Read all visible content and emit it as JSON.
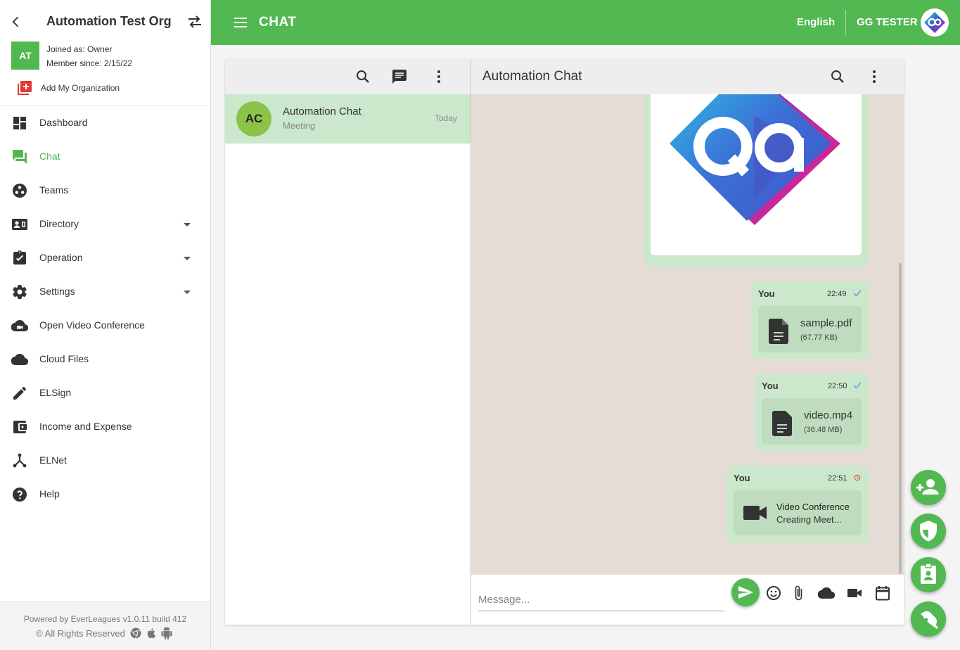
{
  "colors": {
    "primary": "#52b852",
    "selected_row": "#cce8cc",
    "chat_bg": "#e5ddd5",
    "active_nav": "#4fb84f"
  },
  "sidebar": {
    "org_name": "Automation Test Org",
    "org_initials": "AT",
    "joined": "Joined as: Owner",
    "member_since": "Member since: 2/15/22",
    "add_org": "Add My Organization",
    "items": [
      {
        "label": "Dashboard",
        "icon": "dashboard-icon"
      },
      {
        "label": "Chat",
        "icon": "chat-icon",
        "active": true
      },
      {
        "label": "Teams",
        "icon": "teams-icon"
      },
      {
        "label": "Directory",
        "icon": "contact-card-icon",
        "expandable": true
      },
      {
        "label": "Operation",
        "icon": "assignment-icon",
        "expandable": true
      },
      {
        "label": "Settings",
        "icon": "gear-icon",
        "expandable": true
      },
      {
        "label": "Open Video Conference",
        "icon": "video-cloud-icon"
      },
      {
        "label": "Cloud Files",
        "icon": "cloud-icon"
      },
      {
        "label": "ELSign",
        "icon": "pen-icon"
      },
      {
        "label": "Income and Expense",
        "icon": "wallet-icon"
      },
      {
        "label": "ELNet",
        "icon": "network-icon"
      },
      {
        "label": "Help",
        "icon": "help-icon"
      }
    ],
    "footer": {
      "powered": "Powered by EverLeagues v1.0.11 build 412",
      "rights": "© All Rights Reserved"
    }
  },
  "topbar": {
    "title": "CHAT",
    "language": "English",
    "user_name": "GG TESTER"
  },
  "chat_list": {
    "items": [
      {
        "initials": "AC",
        "name": "Automation Chat",
        "subtitle": "Meeting",
        "time": "Today"
      }
    ]
  },
  "conversation": {
    "title": "Automation Chat",
    "messages": [
      {
        "type": "image",
        "image": "qa-logo"
      },
      {
        "type": "file",
        "sender": "You",
        "time": "22:49",
        "status": "sent",
        "file_name": "sample.pdf",
        "file_size": "(67.77 KB)"
      },
      {
        "type": "file",
        "sender": "You",
        "time": "22:50",
        "status": "sent",
        "file_name": "video.mp4",
        "file_size": "(36.48 MB)"
      },
      {
        "type": "video_conference",
        "sender": "You",
        "time": "22:51",
        "status": "pending",
        "title": "Video Conference",
        "subtitle": "Creating Meet..."
      }
    ],
    "compose": {
      "placeholder": "Message...",
      "value": ""
    }
  },
  "fabs": [
    "add-person-icon",
    "shield-icon",
    "badge-icon",
    "rocket-icon"
  ]
}
